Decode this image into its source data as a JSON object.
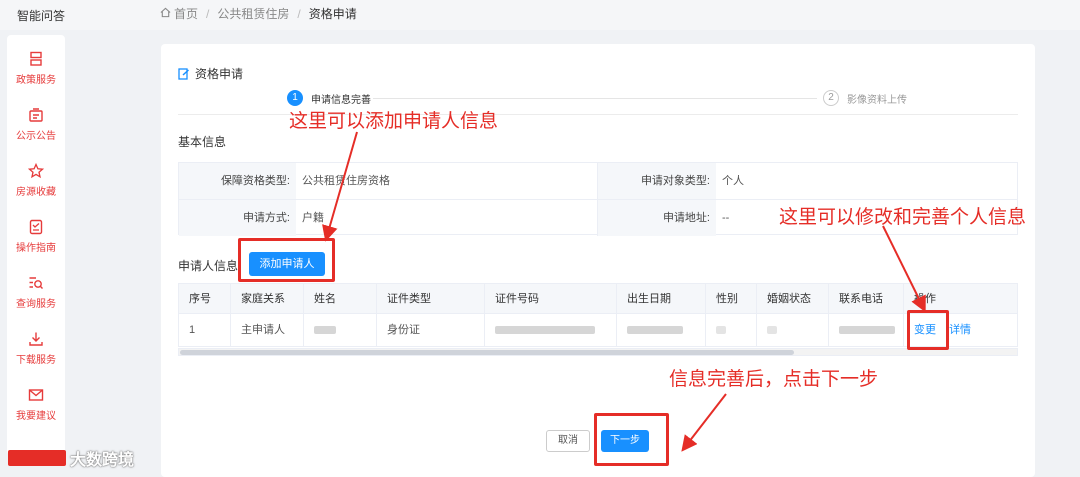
{
  "app": {
    "brand": "智能问答"
  },
  "breadcrumb": {
    "home": "首页",
    "sep": "/",
    "level2": "公共租赁住房",
    "current": "资格申请"
  },
  "sidebar": {
    "items": [
      {
        "label": "政策服务",
        "icon": "policy-icon"
      },
      {
        "label": "公示公告",
        "icon": "notice-icon"
      },
      {
        "label": "房源收藏",
        "icon": "star-icon"
      },
      {
        "label": "操作指南",
        "icon": "guide-icon"
      },
      {
        "label": "查询服务",
        "icon": "query-icon"
      },
      {
        "label": "下载服务",
        "icon": "download-icon"
      },
      {
        "label": "我要建议",
        "icon": "mail-icon"
      }
    ]
  },
  "page": {
    "title": "资格申请"
  },
  "steps": [
    {
      "num": "1",
      "label": "申请信息完善",
      "active": true
    },
    {
      "num": "2",
      "label": "影像资料上传",
      "active": false
    }
  ],
  "basic": {
    "heading": "基本信息",
    "rows": [
      [
        {
          "label": "保障资格类型:",
          "value": "公共租赁住房资格"
        },
        {
          "label": "申请对象类型:",
          "value": "个人"
        }
      ],
      [
        {
          "label": "申请方式:",
          "value": "户籍"
        },
        {
          "label": "申请地址:",
          "value": "--"
        }
      ]
    ]
  },
  "applicant": {
    "heading": "申请人信息",
    "add_button": "添加申请人",
    "columns": [
      "序号",
      "家庭关系",
      "姓名",
      "证件类型",
      "证件号码",
      "出生日期",
      "性别",
      "婚姻状态",
      "联系电话",
      "操作"
    ],
    "rows": [
      {
        "index": "1",
        "relation": "主申请人",
        "id_type": "身份证",
        "action_change": "变更",
        "action_detail": "详情"
      }
    ]
  },
  "footer": {
    "cancel": "取消",
    "next": "下一步"
  },
  "annotations": {
    "add": "这里可以添加申请人信息",
    "modify": "这里可以修改和完善个人信息",
    "next": "信息完善后，点击下一步"
  },
  "watermark": {
    "text": "大数跨境"
  },
  "colors": {
    "accent": "#1890ff",
    "annotation": "#e52d27",
    "sidebar_text": "#e63b3b"
  }
}
